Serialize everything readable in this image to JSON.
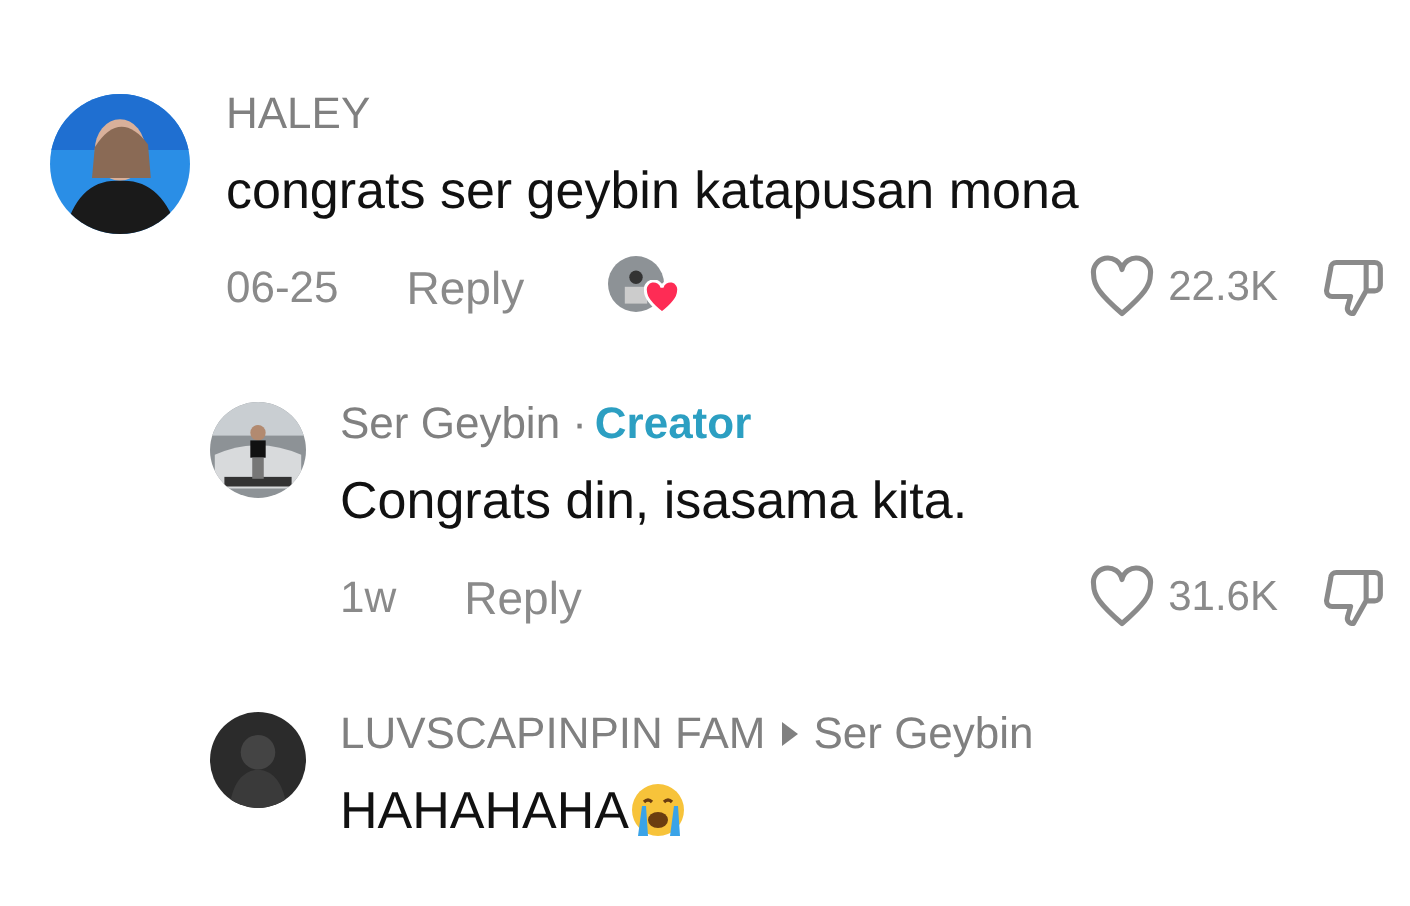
{
  "comments": [
    {
      "username": "HALEY",
      "text": "congrats ser geybin katapusan mona",
      "time": "06-25",
      "reply_label": "Reply",
      "liked_by_creator": true,
      "like_count": "22.3K",
      "replies": [
        {
          "username": "Ser Geybin",
          "separator": "·",
          "badge": "Creator",
          "text": "Congrats din, isasama kita.",
          "time": "1w",
          "reply_label": "Reply",
          "like_count": "31.6K"
        },
        {
          "username": "LUVSCAPINPIN FAM",
          "reply_to": "Ser Geybin",
          "text": "HAHAHAHA",
          "has_emoji": true
        }
      ]
    }
  ]
}
